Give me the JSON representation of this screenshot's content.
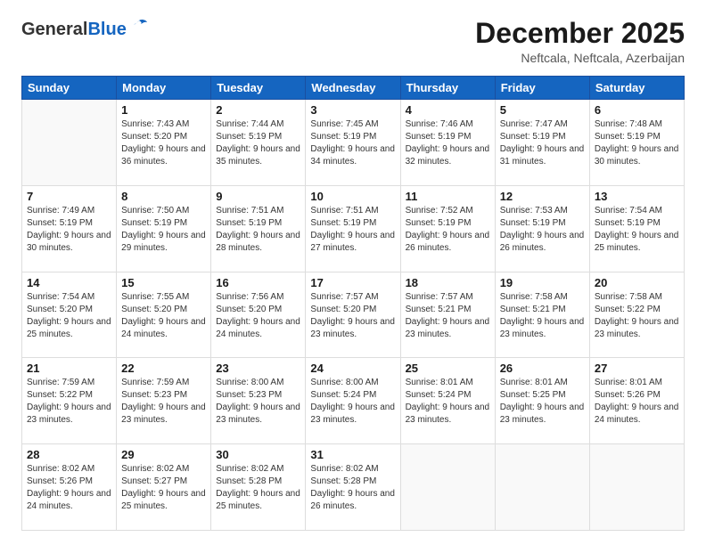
{
  "logo": {
    "general": "General",
    "blue": "Blue"
  },
  "header": {
    "month": "December 2025",
    "location": "Neftcala, Neftcala, Azerbaijan"
  },
  "days_of_week": [
    "Sunday",
    "Monday",
    "Tuesday",
    "Wednesday",
    "Thursday",
    "Friday",
    "Saturday"
  ],
  "weeks": [
    [
      {
        "day": "",
        "info": ""
      },
      {
        "day": "1",
        "info": "Sunrise: 7:43 AM\nSunset: 5:20 PM\nDaylight: 9 hours\nand 36 minutes."
      },
      {
        "day": "2",
        "info": "Sunrise: 7:44 AM\nSunset: 5:19 PM\nDaylight: 9 hours\nand 35 minutes."
      },
      {
        "day": "3",
        "info": "Sunrise: 7:45 AM\nSunset: 5:19 PM\nDaylight: 9 hours\nand 34 minutes."
      },
      {
        "day": "4",
        "info": "Sunrise: 7:46 AM\nSunset: 5:19 PM\nDaylight: 9 hours\nand 32 minutes."
      },
      {
        "day": "5",
        "info": "Sunrise: 7:47 AM\nSunset: 5:19 PM\nDaylight: 9 hours\nand 31 minutes."
      },
      {
        "day": "6",
        "info": "Sunrise: 7:48 AM\nSunset: 5:19 PM\nDaylight: 9 hours\nand 30 minutes."
      }
    ],
    [
      {
        "day": "7",
        "info": "Sunrise: 7:49 AM\nSunset: 5:19 PM\nDaylight: 9 hours\nand 30 minutes."
      },
      {
        "day": "8",
        "info": "Sunrise: 7:50 AM\nSunset: 5:19 PM\nDaylight: 9 hours\nand 29 minutes."
      },
      {
        "day": "9",
        "info": "Sunrise: 7:51 AM\nSunset: 5:19 PM\nDaylight: 9 hours\nand 28 minutes."
      },
      {
        "day": "10",
        "info": "Sunrise: 7:51 AM\nSunset: 5:19 PM\nDaylight: 9 hours\nand 27 minutes."
      },
      {
        "day": "11",
        "info": "Sunrise: 7:52 AM\nSunset: 5:19 PM\nDaylight: 9 hours\nand 26 minutes."
      },
      {
        "day": "12",
        "info": "Sunrise: 7:53 AM\nSunset: 5:19 PM\nDaylight: 9 hours\nand 26 minutes."
      },
      {
        "day": "13",
        "info": "Sunrise: 7:54 AM\nSunset: 5:19 PM\nDaylight: 9 hours\nand 25 minutes."
      }
    ],
    [
      {
        "day": "14",
        "info": "Sunrise: 7:54 AM\nSunset: 5:20 PM\nDaylight: 9 hours\nand 25 minutes."
      },
      {
        "day": "15",
        "info": "Sunrise: 7:55 AM\nSunset: 5:20 PM\nDaylight: 9 hours\nand 24 minutes."
      },
      {
        "day": "16",
        "info": "Sunrise: 7:56 AM\nSunset: 5:20 PM\nDaylight: 9 hours\nand 24 minutes."
      },
      {
        "day": "17",
        "info": "Sunrise: 7:57 AM\nSunset: 5:20 PM\nDaylight: 9 hours\nand 23 minutes."
      },
      {
        "day": "18",
        "info": "Sunrise: 7:57 AM\nSunset: 5:21 PM\nDaylight: 9 hours\nand 23 minutes."
      },
      {
        "day": "19",
        "info": "Sunrise: 7:58 AM\nSunset: 5:21 PM\nDaylight: 9 hours\nand 23 minutes."
      },
      {
        "day": "20",
        "info": "Sunrise: 7:58 AM\nSunset: 5:22 PM\nDaylight: 9 hours\nand 23 minutes."
      }
    ],
    [
      {
        "day": "21",
        "info": "Sunrise: 7:59 AM\nSunset: 5:22 PM\nDaylight: 9 hours\nand 23 minutes."
      },
      {
        "day": "22",
        "info": "Sunrise: 7:59 AM\nSunset: 5:23 PM\nDaylight: 9 hours\nand 23 minutes."
      },
      {
        "day": "23",
        "info": "Sunrise: 8:00 AM\nSunset: 5:23 PM\nDaylight: 9 hours\nand 23 minutes."
      },
      {
        "day": "24",
        "info": "Sunrise: 8:00 AM\nSunset: 5:24 PM\nDaylight: 9 hours\nand 23 minutes."
      },
      {
        "day": "25",
        "info": "Sunrise: 8:01 AM\nSunset: 5:24 PM\nDaylight: 9 hours\nand 23 minutes."
      },
      {
        "day": "26",
        "info": "Sunrise: 8:01 AM\nSunset: 5:25 PM\nDaylight: 9 hours\nand 23 minutes."
      },
      {
        "day": "27",
        "info": "Sunrise: 8:01 AM\nSunset: 5:26 PM\nDaylight: 9 hours\nand 24 minutes."
      }
    ],
    [
      {
        "day": "28",
        "info": "Sunrise: 8:02 AM\nSunset: 5:26 PM\nDaylight: 9 hours\nand 24 minutes."
      },
      {
        "day": "29",
        "info": "Sunrise: 8:02 AM\nSunset: 5:27 PM\nDaylight: 9 hours\nand 25 minutes."
      },
      {
        "day": "30",
        "info": "Sunrise: 8:02 AM\nSunset: 5:28 PM\nDaylight: 9 hours\nand 25 minutes."
      },
      {
        "day": "31",
        "info": "Sunrise: 8:02 AM\nSunset: 5:28 PM\nDaylight: 9 hours\nand 26 minutes."
      },
      {
        "day": "",
        "info": ""
      },
      {
        "day": "",
        "info": ""
      },
      {
        "day": "",
        "info": ""
      }
    ]
  ]
}
